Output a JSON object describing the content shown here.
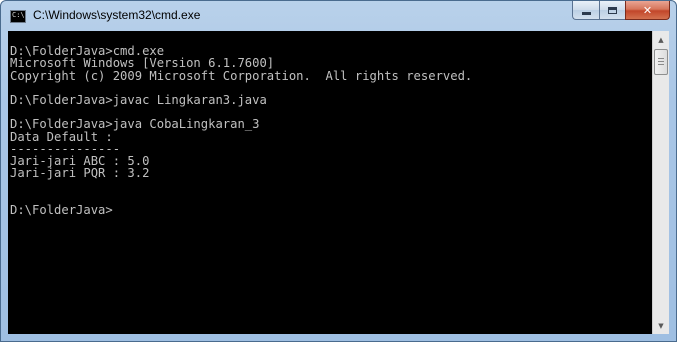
{
  "window": {
    "title": "C:\\Windows\\system32\\cmd.exe",
    "icon": "cmd-icon",
    "icon_text": "C:\\"
  },
  "caption_buttons": {
    "minimize": "minimize-icon",
    "maximize": "maximize-icon",
    "close": "close-icon",
    "close_glyph": "✕"
  },
  "console": {
    "lines": [
      "",
      "D:\\FolderJava>cmd.exe",
      "Microsoft Windows [Version 6.1.7600]",
      "Copyright (c) 2009 Microsoft Corporation.  All rights reserved.",
      "",
      "D:\\FolderJava>javac Lingkaran3.java",
      "",
      "D:\\FolderJava>java CobaLingkaran_3",
      "Data Default :",
      "---------------",
      "Jari-jari ABC : 5.0",
      "Jari-jari PQR : 3.2",
      "",
      "",
      "D:\\FolderJava>"
    ]
  },
  "scrollbar": {
    "up_glyph": "▲",
    "down_glyph": "▼"
  },
  "colors": {
    "console_bg": "#000000",
    "console_fg": "#c0c0c0",
    "close_button": "#c2462a"
  }
}
